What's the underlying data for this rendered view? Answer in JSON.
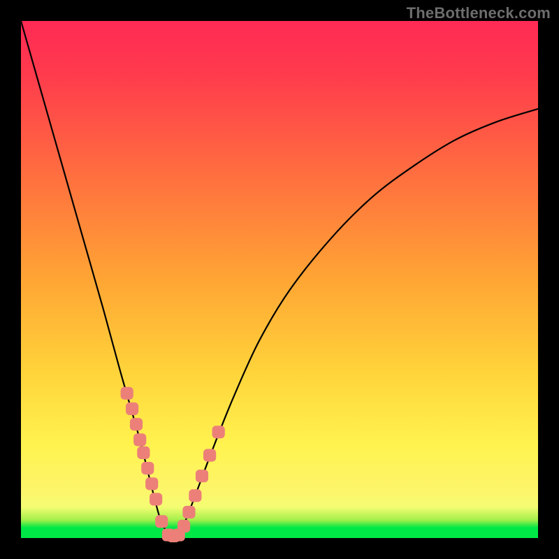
{
  "watermark": "TheBottleneck.com",
  "colors": {
    "background": "#000000",
    "curve": "#000000",
    "markerFill": "#ec8079",
    "markerStroke": "#ec8079",
    "gradientTop": "#ff2a55",
    "gradientBottom": "#00e845"
  },
  "chart_data": {
    "type": "line",
    "title": "",
    "xlabel": "",
    "ylabel": "",
    "xlim": [
      0,
      100
    ],
    "ylim": [
      0,
      100
    ],
    "legend": false,
    "grid": false,
    "series": [
      {
        "name": "bottleneck-curve",
        "x": [
          0,
          4,
          8,
          12,
          16,
          19,
          21,
          23,
          24.5,
          26,
          27,
          28,
          29,
          30,
          31,
          32,
          34,
          37,
          41,
          46,
          52,
          60,
          68,
          76,
          84,
          92,
          100
        ],
        "y": [
          100,
          86,
          72,
          58,
          44,
          33,
          26,
          19,
          13,
          7,
          3.5,
          1.5,
          0.3,
          0.3,
          1.5,
          3.8,
          9,
          17,
          27,
          38,
          48,
          58,
          66,
          72,
          77,
          80.5,
          83
        ]
      }
    ],
    "markers": {
      "name": "highlighted-points",
      "x": [
        20.5,
        21.5,
        22.3,
        23.0,
        23.7,
        24.5,
        25.3,
        26.1,
        27.2,
        28.5,
        29.5,
        30.5,
        31.5,
        32.5,
        33.7,
        35.0,
        36.5,
        38.2
      ],
      "y": [
        28,
        25,
        22,
        19,
        16.5,
        13.5,
        10.5,
        7.5,
        3.2,
        0.6,
        0.4,
        0.6,
        2.3,
        5,
        8.2,
        12,
        16,
        20.5
      ]
    }
  }
}
